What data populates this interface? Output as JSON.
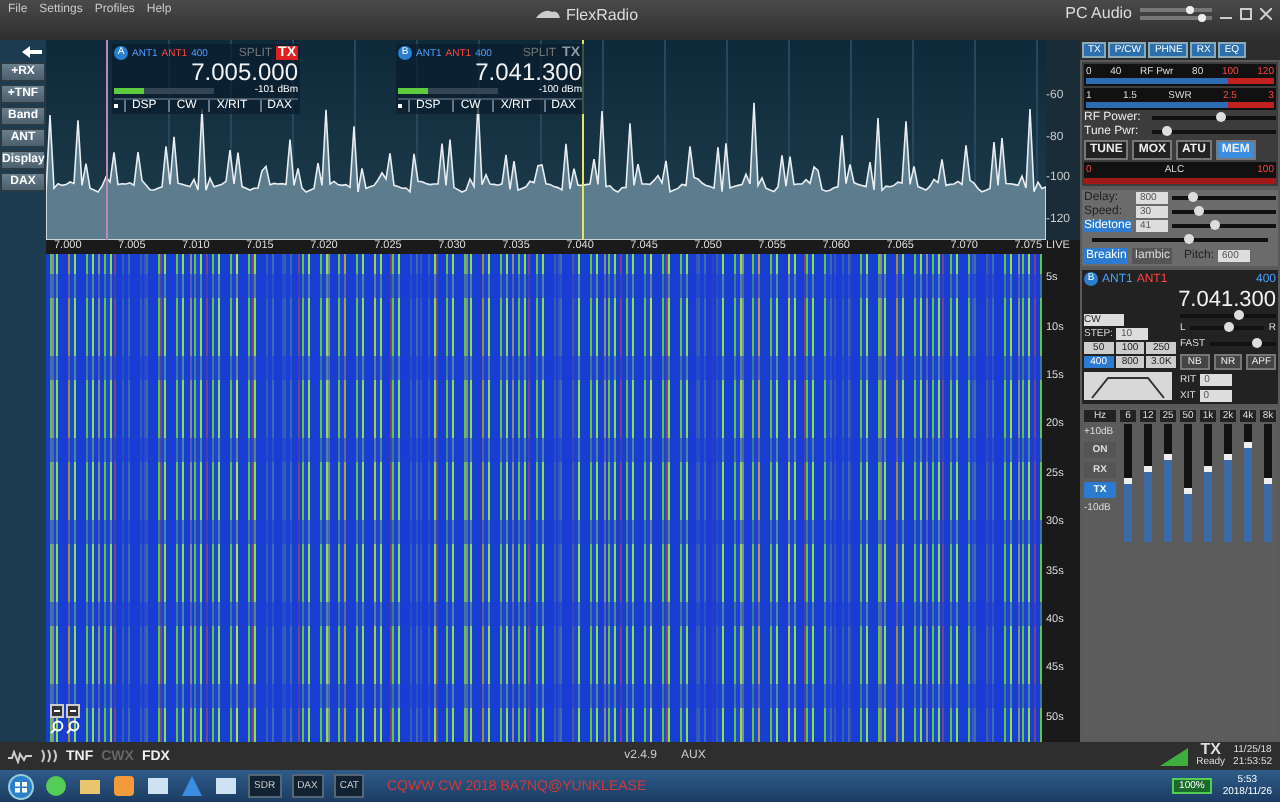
{
  "menu": [
    "File",
    "Settings",
    "Profiles",
    "Help"
  ],
  "window": {
    "title": "FlexRadio",
    "audio": "PC Audio"
  },
  "audio_sliders": [
    {
      "level": 0.7
    },
    {
      "level": 0.85
    }
  ],
  "side_buttons": [
    "+RX",
    "+TNF",
    "Band",
    "ANT",
    "Display",
    "DAX"
  ],
  "slices": [
    {
      "letter": "A",
      "ant_rx": "ANT1",
      "ant_tx": "ANT1",
      "bw": "400",
      "split": "SPLIT",
      "tx_label": "TX",
      "tx": true,
      "frequency": "7.005.000",
      "dbm": "-101 dBm",
      "level": 0.3,
      "buttons": [
        "DSP",
        "CW",
        "X/RIT",
        "DAX"
      ]
    },
    {
      "letter": "B",
      "ant_rx": "ANT1",
      "ant_tx": "ANT1",
      "bw": "400",
      "split": "SPLIT",
      "tx_label": "TX",
      "tx": false,
      "frequency": "7.041.300",
      "dbm": "-100 dBm",
      "level": 0.3,
      "buttons": [
        "DSP",
        "CW",
        "X/RIT",
        "DAX"
      ]
    }
  ],
  "dbm_axis": [
    "-60",
    "-80",
    "-100",
    "-120"
  ],
  "freq_axis": [
    "7.000",
    "7.005",
    "7.010",
    "7.015",
    "7.020",
    "7.025",
    "7.030",
    "7.035",
    "7.040",
    "7.045",
    "7.050",
    "7.055",
    "7.060",
    "7.065",
    "7.070",
    "7.075"
  ],
  "live": "LIVE",
  "time_axis": [
    "5s",
    "10s",
    "15s",
    "20s",
    "25s",
    "30s",
    "35s",
    "40s",
    "45s",
    "50s"
  ],
  "panel_tabs": [
    "TX",
    "P/CW",
    "PHNE",
    "RX",
    "EQ"
  ],
  "tx": {
    "meters": [
      {
        "scale": [
          "0",
          "40",
          "RF Pwr",
          "80",
          "100",
          "120"
        ]
      },
      {
        "scale": [
          "1",
          "1.5",
          "SWR",
          "2.5",
          "3"
        ]
      }
    ],
    "sliders": [
      {
        "label": "RF Power:",
        "level": 0.55
      },
      {
        "label": "Tune Pwr:",
        "level": 0.12
      }
    ],
    "buttons": [
      {
        "label": "TUNE",
        "on": false
      },
      {
        "label": "MOX",
        "on": false
      },
      {
        "label": "ATU",
        "on": false
      },
      {
        "label": "MEM",
        "on": true
      }
    ],
    "alc": [
      "0",
      "ALC",
      "100"
    ]
  },
  "cw": {
    "fields": [
      {
        "label": "Delay:",
        "value": "800",
        "level": 0.2,
        "selected": false
      },
      {
        "label": "Speed:",
        "value": "30",
        "level": 0.25,
        "selected": false
      },
      {
        "label": "Sidetone",
        "value": "41",
        "level": 0.4,
        "selected": true
      }
    ],
    "extra_slider": {
      "level": 0.55
    },
    "modes": [
      {
        "label": "Breakin",
        "selected": true
      },
      {
        "label": "Iambic",
        "selected": false
      }
    ],
    "pitch_label": "Pitch:",
    "pitch": "600"
  },
  "slice_panel": {
    "letter": "B",
    "ant_rx": "ANT1",
    "ant_tx": "ANT1",
    "bw": "400",
    "frequency": "7.041.300",
    "mode": "CW",
    "step_label": "STEP:",
    "step": "10",
    "filters": [
      {
        "label": "50",
        "selected": false
      },
      {
        "label": "100",
        "selected": false
      },
      {
        "label": "250",
        "selected": false
      },
      {
        "label": "400",
        "selected": true
      },
      {
        "label": "800",
        "selected": false
      },
      {
        "label": "3.0K",
        "selected": false
      }
    ],
    "gain": {
      "level": 0.6
    },
    "pan": {
      "level": 0.5
    },
    "left": "L",
    "right": "R",
    "agc_label": "FAST",
    "agc": {
      "level": 0.7
    },
    "dsp": [
      "NB",
      "NR",
      "APF"
    ],
    "offsets": [
      {
        "label": "RIT",
        "value": "0"
      },
      {
        "label": "XIT",
        "value": "0"
      }
    ]
  },
  "eq": {
    "unit": "Hz",
    "bands": [
      {
        "label": "6",
        "level": 0.5
      },
      {
        "label": "12",
        "level": 0.6
      },
      {
        "label": "25",
        "level": 0.7
      },
      {
        "label": "50",
        "level": 0.4
      },
      {
        "label": "1k",
        "level": 0.6
      },
      {
        "label": "2k",
        "level": 0.7
      },
      {
        "label": "4k",
        "level": 0.8
      },
      {
        "label": "8k",
        "level": 0.5
      }
    ],
    "top": "+10dB",
    "bottom": "-10dB",
    "buttons": [
      {
        "label": "ON",
        "selected": false
      },
      {
        "label": "RX",
        "selected": false
      },
      {
        "label": "TX",
        "selected": true
      }
    ]
  },
  "status": {
    "items": [
      {
        "label": "TNF",
        "enabled": true
      },
      {
        "label": "CWX",
        "enabled": false
      },
      {
        "label": "FDX",
        "enabled": true
      }
    ],
    "version": "v2.4.9",
    "aux": "AUX",
    "tx": "TX",
    "tx_state": "Ready",
    "date": "11/25/18",
    "time": "21:53:52"
  },
  "taskbar": {
    "apps": [
      "SDR",
      "DAX",
      "CAT"
    ],
    "caption": "CQWW CW 2018 BA7NQ@YUNKLEASE",
    "battery": "100%",
    "time": "5:53",
    "date": "2018/11/26"
  }
}
